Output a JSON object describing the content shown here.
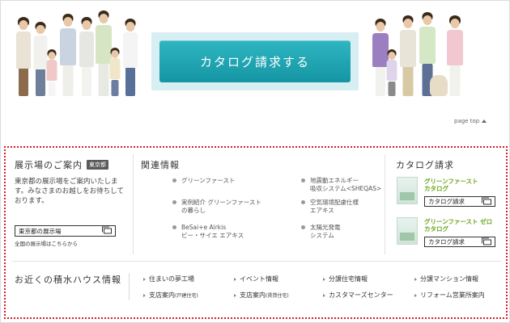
{
  "hero": {
    "catalog_button": "カタログ請求する",
    "page_top": "page top"
  },
  "showroom": {
    "title": "展示場のご案内",
    "badge": "東京都",
    "description": "東京都の展示場をご案内いたします。みなさまのお越しをお待ちしております。",
    "button": "東京都の展示場",
    "all_link": "全国の展示場はこちらから"
  },
  "related": {
    "title": "関連情報",
    "items": [
      {
        "line1": "グリーンファースト",
        "line2": ""
      },
      {
        "line1": "実例紹介 グリーンファースト",
        "line2": "の暮らし"
      },
      {
        "line1": "BeSai+e Airkis",
        "line2": "ビー・サイエ エアキス"
      },
      {
        "line1": "地震動エネルギー",
        "line2": "吸収システム<SHEQAS>"
      },
      {
        "line1": "空気環境配慮仕様",
        "line2": "エアキス"
      },
      {
        "line1": "太陽光発電",
        "line2": "システム"
      }
    ]
  },
  "catalog": {
    "title": "カタログ請求",
    "items": [
      {
        "name1": "グリーンファースト",
        "name2": "カタログ",
        "button": "カタログ請求"
      },
      {
        "name1": "グリーンファースト ゼロ",
        "name2": "カタログ",
        "button": "カタログ請求"
      }
    ]
  },
  "nearby": {
    "title": "お近くの積水ハウス情報",
    "links": [
      {
        "text": "住まいの夢工場",
        "sub": ""
      },
      {
        "text": "イベント情報",
        "sub": ""
      },
      {
        "text": "分譲住宅情報",
        "sub": ""
      },
      {
        "text": "分譲マンション情報",
        "sub": ""
      },
      {
        "text": "支店案内",
        "sub": "(戸建住宅)"
      },
      {
        "text": "支店案内",
        "sub": "(賃貸住宅)"
      },
      {
        "text": "カスタマーズセンター",
        "sub": ""
      },
      {
        "text": "リフォーム営業所案内",
        "sub": ""
      }
    ]
  },
  "colors": {
    "accent_teal": "#1fa9b6",
    "border_red": "#d81b2a",
    "green_text": "#6aa51a"
  }
}
